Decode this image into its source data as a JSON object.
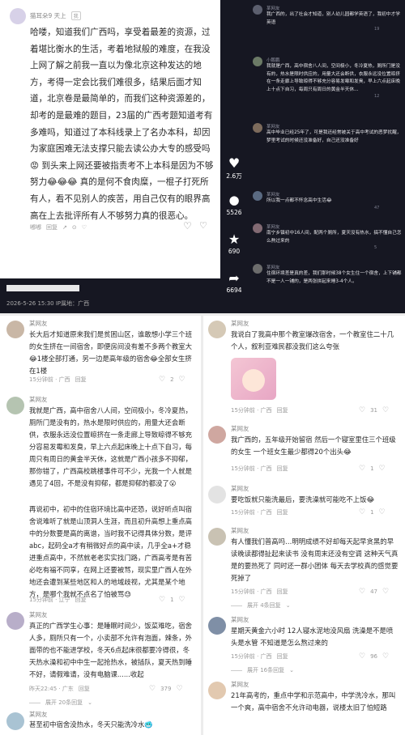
{
  "post_top": {
    "username": "猫耳朵9 天上",
    "badge": "我",
    "body": "哈喽，知道我们广西吗，享受着最差的资源，过着堪比衡水的生活，考着地狱般的难度，在我没上网了解之前我一直以为像北京这种发达的地方，考得一定会比我们难很多，结果后面才知道，北京卷是最简单的，而我们这种资源差的，却考的是最难的题目，23届的广西考题知道考有多难吗，知道过了本科线录上了名办本科，却因为家庭困难无法支撑只能去读公办大专的感受吗😡 到头来上网还要被指责考不上本科是因为不够努力😂😂😂 真的是何不食肉糜，一棍子打死所有人，看不见别人的疾苦，用自己仅有的眼界高高在上去批评所有人不够努力真的很恶心。",
    "more": "收起",
    "meta": "2026-5-26 15:30 IP属地：广西",
    "actions": [
      "回复",
      "♡"
    ]
  },
  "post_left": [
    {
      "name": "某网友",
      "text": "长大后才知道原来我们是贫困山区，谁敢想小学三个班的女生挤在一间宿舍，即便房间没有差不多两个教室大😂1楼全部打通，另一边是高年级的宿舍😂全部女生挤在1楼",
      "meta": "15分钟前 · 广西",
      "reply": "回复",
      "likes": "2"
    },
    {
      "name": "某网友",
      "text": "我就是广西，高中宿舍八人间，空间极小，冬冷夏热，厕所门是没有的，热水是限时供应的，用量大还会断供，衣服永远没位置晾挤在一条走廊上导致晾得不够充分容易发霉和发臭，早上六点起床晚上十点下自习，每周只有周日的黄金半天休，这就是广西小孩多不抑郁，那你错了，广西高校跳楼事件可不少，光我一个人就是遇见了4回，不是没有抑郁，都是抑郁的都没了😮",
      "meta": "",
      "reply": "",
      "likes": ""
    },
    {
      "name": "",
      "text": "再说初中，初中的住宿环境比高中还恐，说好听点叫宿舍说难听了就是山顶洞人生涯，而且初升高想上重点高中的分数要是高的离谱，当时我不记得具体分数，是评abc，起码全a才有稍微好点的高中读，几乎全a+才稳进重点高中，不然就老老实实找门路，广西高考是有苦必吃有福不同享，在网上还要被骂，现实里广西人在外地还会遭到某些地区和人的地域歧视，尤其是某个地方，是哪个我就不点名了怕被骂😓",
      "meta": "15分钟前 · 辽宁",
      "reply": "回复",
      "likes": "1"
    },
    {
      "name": "某网友",
      "text": "真正的广西学生心事：是睡眠时间少，饭菜难吃，宿舍人多，厕所只有一个，小卖部不允许有泡面，辣条，外面带的也不能进学校，冬天6点起床很都要冷得很，冬天热水澡和初中中生一起抢热水，被插队，夏天热到睡不好，请假难请，没有电脑课......收起",
      "meta": "昨天22:45 · 广东",
      "reply": "回复",
      "likes": "379"
    },
    {
      "name": "",
      "text": "展开 20条回复",
      "meta": "",
      "reply": "",
      "likes": ""
    },
    {
      "name": "某网友",
      "text": "甚至初中宿舍没热水，冬天只能洗冷水🥶",
      "meta": "",
      "reply": "",
      "likes": ""
    }
  ],
  "post_right": [
    {
      "name": "某网友",
      "text": "我说白了我高中那个教室爆改宿舍，一个教室住二十几个人，叙利亚难民都没我们这么夸张",
      "meta": "15分钟前 · 广西",
      "reply": "回复",
      "likes": "31"
    },
    {
      "name": "某网友",
      "text": "我广西的，五年级开始留宿 然后一个寝室里住三个班级的女生 一个班女生最少都得20个出头😂",
      "meta": "15分钟前 · 广西",
      "reply": "回复",
      "likes": "1"
    },
    {
      "name": "某网友",
      "text": "要吃饭就只能洗最后，要洗澡就可能吃不上饭😂",
      "meta": "15分钟前 · 广西",
      "reply": "回复",
      "likes": "1"
    },
    {
      "name": "某网友",
      "text": "有人懂我们普高吗…明明成绩不好却每天起早贪黑的早读晚读都得扯起来读书 没有周末还没有空调 这种天气真是的要热死了 同时还一群小团体 每天去学校真的感觉要死掉了",
      "meta": "15分钟前 · 广西",
      "reply": "回复",
      "likes": "47"
    },
    {
      "name": "",
      "text": "展开 4条回复",
      "meta": "",
      "reply": "",
      "likes": ""
    },
    {
      "name": "某网友",
      "text": "星期天黄金六小时 12人寝水泥地没风扇 洗澡是不是喷头是水管 不知道是怎么熬过来的",
      "meta": "15分钟前 · 广西",
      "reply": "回复",
      "likes": "96"
    },
    {
      "name": "",
      "text": "展开 16条回复",
      "meta": "",
      "reply": "",
      "likes": ""
    },
    {
      "name": "某网友",
      "text": "21年高考的，重点中学和示范高中，中学洗冷水，那叫一个爽，高中宿舍不允许动电器，说楼太旧了怕短路",
      "meta": "",
      "reply": "",
      "likes": ""
    }
  ],
  "dark_panel": {
    "side_counts": [
      "2.6万",
      "5526",
      "690",
      "6694"
    ],
    "comments": [
      {
        "name": "某网友",
        "text": "我广西的，出了社会才知道，别人幼儿园都学英语了，我初中才学英语",
        "meta": "回复 · 19 ♡",
        "likes": "19"
      },
      {
        "name": "小鹏鹏",
        "text": "我就是广西，高中宿舍八人间，空间极小，冬冷夏热，厕所门是没有的，热水是限时供应的，用量大还会断供，衣服永远没位置晾挤在一条走廊上导致晾得不够充分容易发霉和发臭，早上六点起床晚上十点下自习，每周只有周日的黄金半天休...",
        "meta": "",
        "likes": "12"
      },
      {
        "name": "某网友",
        "text": "高中毕业已经25年了，可是我还经常被关于高中考试的恶梦扰醒，梦里考试的时候还没准备好，自己还没准备好",
        "meta": "",
        "likes": ""
      },
      {
        "name": "某网友",
        "text": "所以我一点都不怀念高中生活😂",
        "meta": "回复 · 47",
        "likes": "47"
      },
      {
        "name": "某网友",
        "text": "南宁乡镇初中16人间，配两个厕所，夏天没有热水，搞不懂自己怎么熬过来的",
        "meta": "回复 · 5",
        "likes": "5"
      },
      {
        "name": "某网友",
        "text": "住宿环境差是真的差，我们那时候38个女生住一个宿舍，上下铺都不是一人一铺的，是两张拼起来睡3-4个人。",
        "meta": "",
        "likes": ""
      }
    ]
  }
}
